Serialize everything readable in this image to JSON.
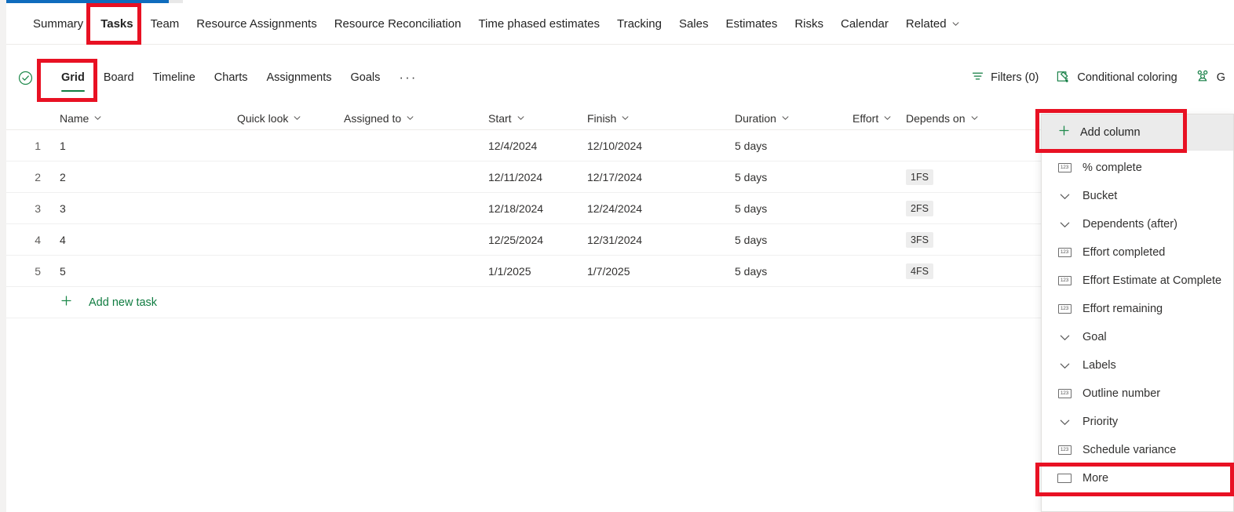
{
  "nav": {
    "tabs": [
      {
        "label": "Summary",
        "selected": false
      },
      {
        "label": "Tasks",
        "selected": true
      },
      {
        "label": "Team",
        "selected": false
      },
      {
        "label": "Resource Assignments",
        "selected": false
      },
      {
        "label": "Resource Reconciliation",
        "selected": false
      },
      {
        "label": "Time phased estimates",
        "selected": false
      },
      {
        "label": "Tracking",
        "selected": false
      },
      {
        "label": "Sales",
        "selected": false
      },
      {
        "label": "Estimates",
        "selected": false
      },
      {
        "label": "Risks",
        "selected": false
      },
      {
        "label": "Calendar",
        "selected": false
      },
      {
        "label": "Related",
        "selected": false,
        "chevron": true
      }
    ]
  },
  "command_bar": {
    "status_icon": "check-circle-icon",
    "view_tabs": [
      {
        "label": "Grid",
        "selected": true
      },
      {
        "label": "Board",
        "selected": false
      },
      {
        "label": "Timeline",
        "selected": false
      },
      {
        "label": "Charts",
        "selected": false
      },
      {
        "label": "Assignments",
        "selected": false
      },
      {
        "label": "Goals",
        "selected": false
      }
    ],
    "overflow_label": "···",
    "actions": [
      {
        "label": "Filters (0)",
        "icon": "filter-icon"
      },
      {
        "label": "Conditional coloring",
        "icon": "conditional-coloring-icon"
      },
      {
        "label": "G",
        "icon": "group-people-icon"
      }
    ]
  },
  "grid": {
    "columns": [
      {
        "label": ""
      },
      {
        "label": "Name"
      },
      {
        "label": "Quick look"
      },
      {
        "label": "Assigned to"
      },
      {
        "label": "Start"
      },
      {
        "label": "Finish"
      },
      {
        "label": "Duration"
      },
      {
        "label": "Effort"
      },
      {
        "label": "Depends on"
      }
    ],
    "rows": [
      {
        "index": "1",
        "name": "1",
        "quick_look": "",
        "assigned_to": "",
        "start": "12/4/2024",
        "finish": "12/10/2024",
        "duration": "5 days",
        "effort": "",
        "depends_on": ""
      },
      {
        "index": "2",
        "name": "2",
        "quick_look": "",
        "assigned_to": "",
        "start": "12/11/2024",
        "finish": "12/17/2024",
        "duration": "5 days",
        "effort": "",
        "depends_on": "1FS"
      },
      {
        "index": "3",
        "name": "3",
        "quick_look": "",
        "assigned_to": "",
        "start": "12/18/2024",
        "finish": "12/24/2024",
        "duration": "5 days",
        "effort": "",
        "depends_on": "2FS"
      },
      {
        "index": "4",
        "name": "4",
        "quick_look": "",
        "assigned_to": "",
        "start": "12/25/2024",
        "finish": "12/31/2024",
        "duration": "5 days",
        "effort": "",
        "depends_on": "3FS"
      },
      {
        "index": "5",
        "name": "5",
        "quick_look": "",
        "assigned_to": "",
        "start": "1/1/2025",
        "finish": "1/7/2025",
        "duration": "5 days",
        "effort": "",
        "depends_on": "4FS"
      }
    ],
    "add_new_task_label": "Add new task"
  },
  "add_column_menu": {
    "button_label": "Add column",
    "button_icon": "plus-icon",
    "items": [
      {
        "label": "% complete",
        "icon": "number-123-icon"
      },
      {
        "label": "Bucket",
        "icon": "chevron-down-icon"
      },
      {
        "label": "Dependents (after)",
        "icon": "chevron-down-icon"
      },
      {
        "label": "Effort completed",
        "icon": "number-123-icon"
      },
      {
        "label": "Effort Estimate at Complete",
        "icon": "number-123-icon"
      },
      {
        "label": "Effort remaining",
        "icon": "number-123-icon"
      },
      {
        "label": "Goal",
        "icon": "chevron-down-icon"
      },
      {
        "label": "Labels",
        "icon": "chevron-down-icon"
      },
      {
        "label": "Outline number",
        "icon": "number-123-icon"
      },
      {
        "label": "Priority",
        "icon": "chevron-down-icon"
      },
      {
        "label": "Schedule variance",
        "icon": "number-123-icon"
      },
      {
        "label": "More",
        "icon": "rectangle-icon"
      }
    ]
  },
  "annotations": {
    "highlight_color": "#e81123",
    "boxes": [
      "tasks-tab",
      "grid-view-tab",
      "add-column-button",
      "more-menu-item"
    ]
  },
  "colors": {
    "accent_green": "#107c41",
    "progress_blue": "#0f6cbd",
    "text": "#323130",
    "badge_bg": "#ededed"
  }
}
